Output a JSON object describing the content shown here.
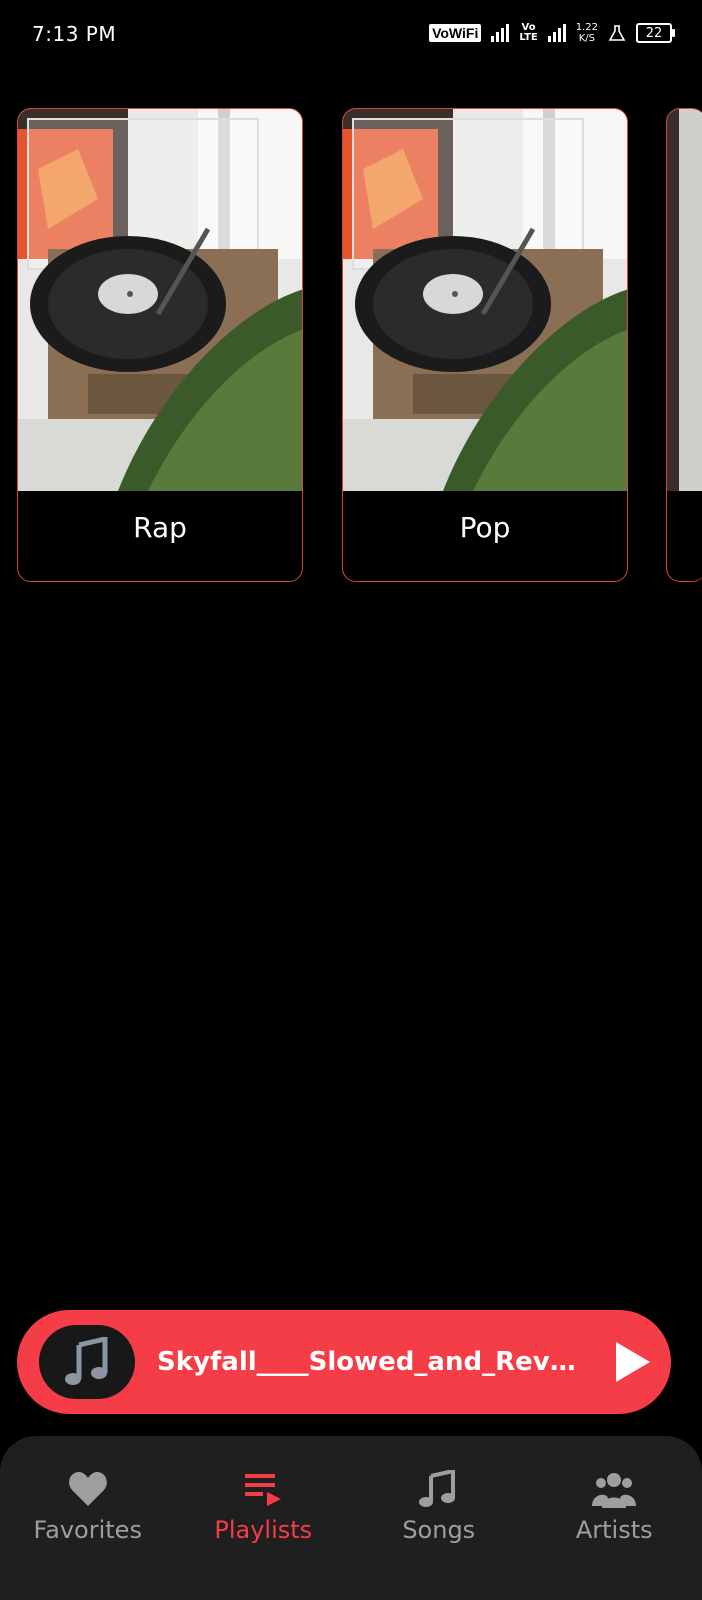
{
  "status_bar": {
    "time": "7:13 PM",
    "vowifi": "VoWiFi",
    "volte_top": "Vo",
    "volte_bottom": "LTE",
    "speed_value": "1.22",
    "speed_unit": "K/S",
    "battery": "22"
  },
  "playlists": [
    {
      "name": "Rap"
    },
    {
      "name": "Pop"
    }
  ],
  "now_playing": {
    "title": "Skyfall____Slowed_and_Reve..."
  },
  "bottom_nav": {
    "items": [
      {
        "label": "Favorites",
        "icon": "heart-icon"
      },
      {
        "label": "Playlists",
        "icon": "playlist-icon",
        "active": true
      },
      {
        "label": "Songs",
        "icon": "music-note-icon"
      },
      {
        "label": "Artists",
        "icon": "people-icon"
      }
    ]
  },
  "colors": {
    "accent": "#f53d48",
    "card_border": "#d8453f",
    "nav_bg": "#1f1f1f",
    "nav_inactive": "#9e9e9e"
  }
}
